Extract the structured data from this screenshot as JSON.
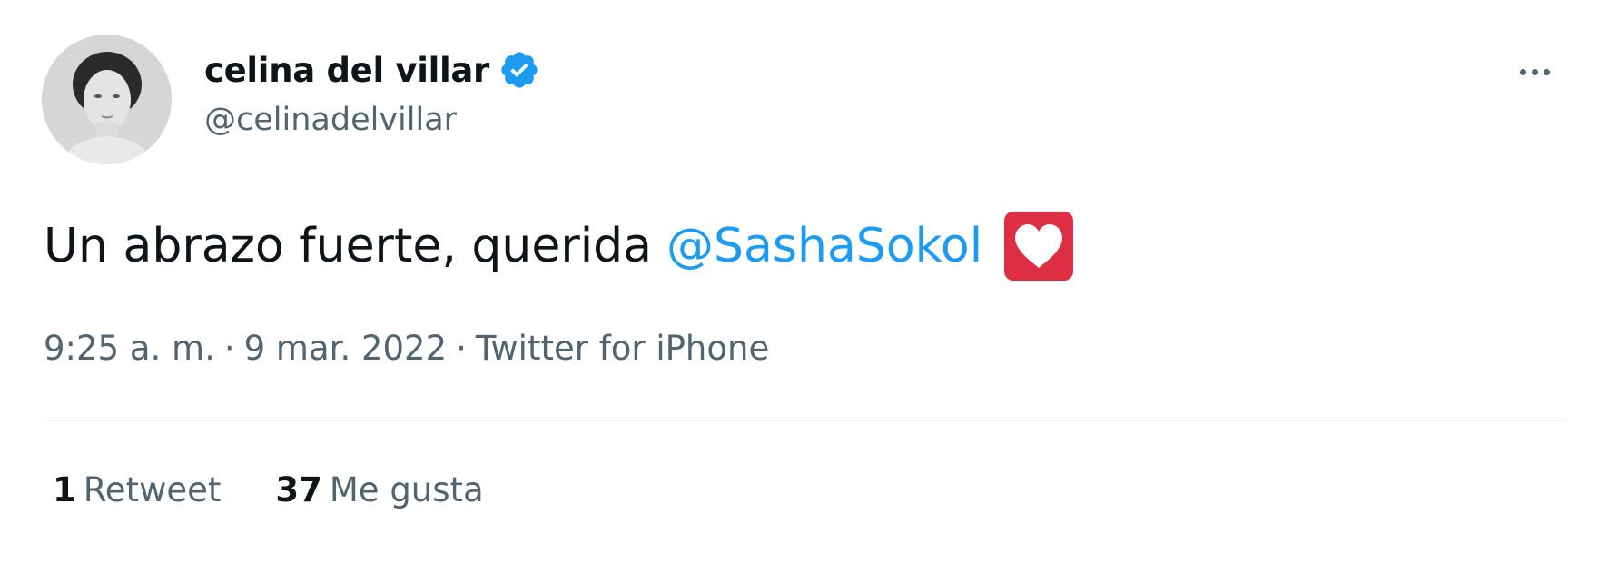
{
  "author": {
    "display_name": "celina del villar",
    "handle": "@celinadelvillar",
    "verified": true
  },
  "tweet": {
    "text": "Un abrazo fuerte, querida",
    "mention": "@SashaSokol",
    "emoji_icon": "white-heart-icon",
    "time": "9:25 a. m.",
    "date": "9 mar. 2022",
    "source": "Twitter for iPhone",
    "separator": "·"
  },
  "stats": {
    "retweets_count": "1",
    "retweets_label": "Retweet",
    "likes_count": "37",
    "likes_label": "Me gusta"
  },
  "colors": {
    "accent": "#1d9bf0",
    "text": "#0f1419",
    "secondary": "#536471",
    "emoji_bg": "#dd2e44"
  }
}
